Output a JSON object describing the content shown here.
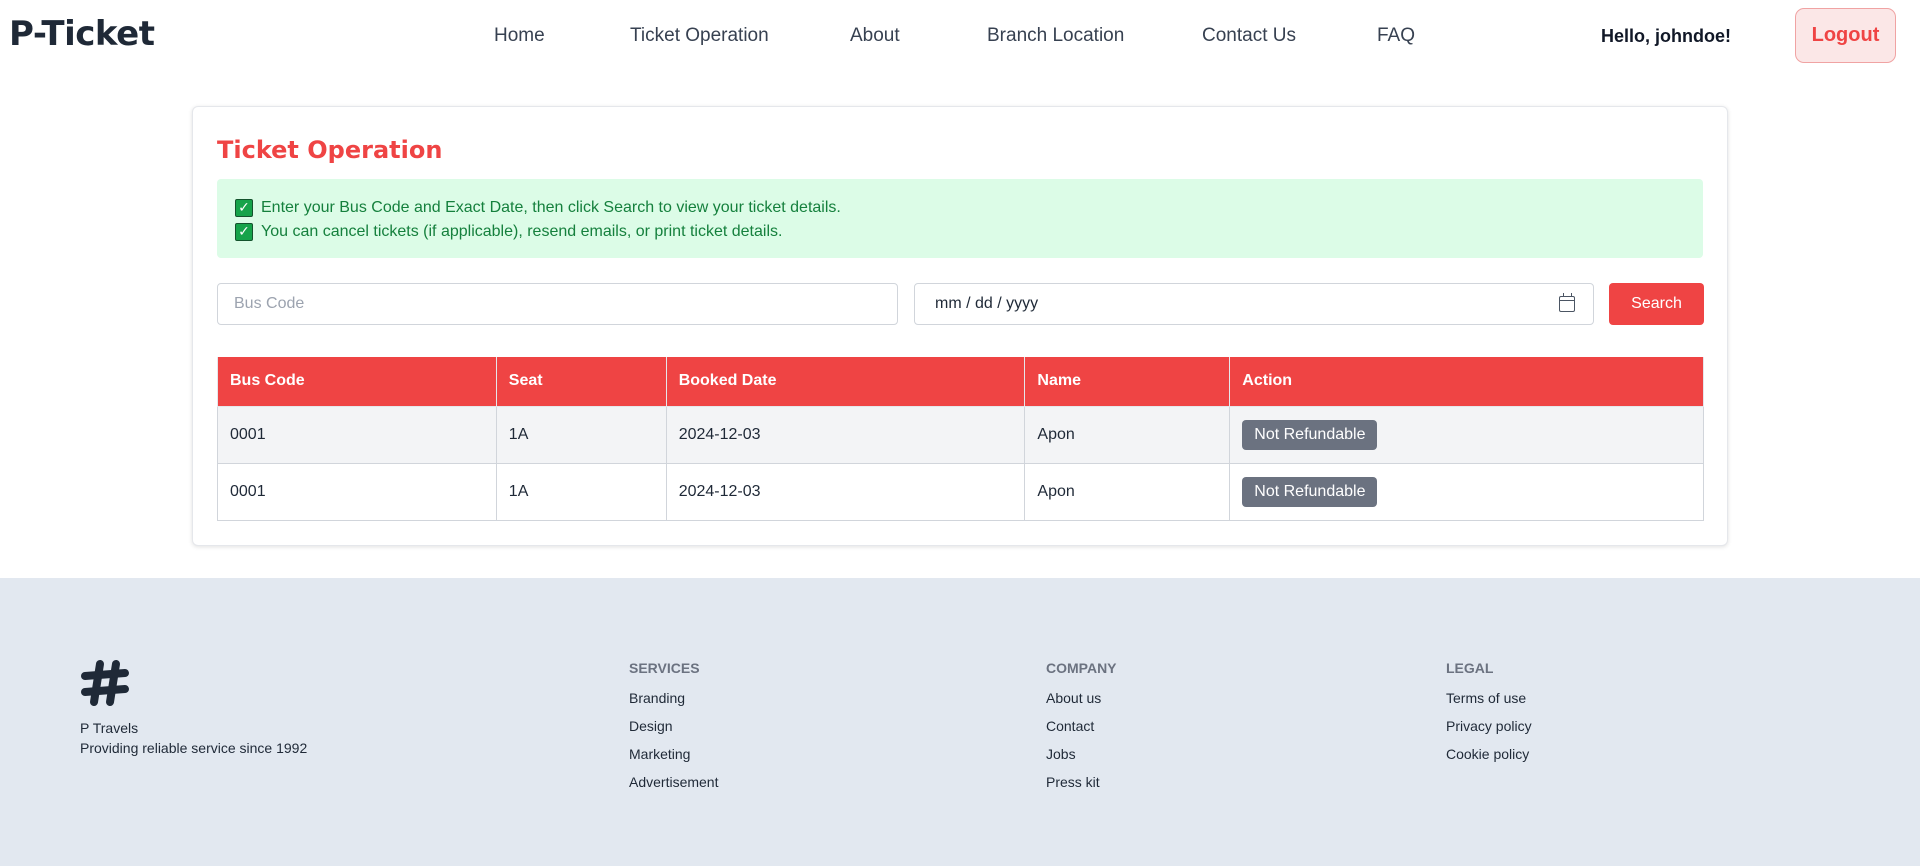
{
  "header": {
    "brand": "P-Ticket",
    "nav": [
      {
        "label": "Home"
      },
      {
        "label": "Ticket Operation"
      },
      {
        "label": "About"
      },
      {
        "label": "Branch Location"
      },
      {
        "label": "Contact Us"
      },
      {
        "label": "FAQ"
      }
    ],
    "greeting": "Hello, johndoe!",
    "logout_label": "Logout"
  },
  "main": {
    "title": "Ticket Operation",
    "notices": [
      "Enter your Bus Code and Exact Date, then click Search to view your ticket details.",
      "You can cancel tickets (if applicable), resend emails, or print ticket details."
    ],
    "bus_code_placeholder": "Bus Code",
    "date_placeholder": "mm / dd / yyyy",
    "search_label": "Search",
    "table": {
      "columns": [
        "Bus Code",
        "Seat",
        "Booked Date",
        "Name",
        "Action"
      ],
      "rows": [
        {
          "bus_code": "0001",
          "seat": "1A",
          "booked_date": "2024-12-03",
          "name": "Apon",
          "action": "Not Refundable"
        },
        {
          "bus_code": "0001",
          "seat": "1A",
          "booked_date": "2024-12-03",
          "name": "Apon",
          "action": "Not Refundable"
        }
      ]
    }
  },
  "footer": {
    "company_name": "P Travels",
    "tagline": "Providing reliable service since 1992",
    "columns": [
      {
        "heading": "SERVICES",
        "links": [
          "Branding",
          "Design",
          "Marketing",
          "Advertisement"
        ]
      },
      {
        "heading": "COMPANY",
        "links": [
          "About us",
          "Contact",
          "Jobs",
          "Press kit"
        ]
      },
      {
        "heading": "LEGAL",
        "links": [
          "Terms of use",
          "Privacy policy",
          "Cookie policy"
        ]
      }
    ]
  },
  "colors": {
    "accent": "#ef4444",
    "notice_bg": "#dcfce7",
    "notice_text": "#15803d",
    "badge": "#6b7280",
    "footer_bg": "#e2e8f0"
  },
  "icons": {
    "check": "check-box-icon",
    "calendar": "calendar-icon",
    "logo": "hash-logo-icon"
  }
}
